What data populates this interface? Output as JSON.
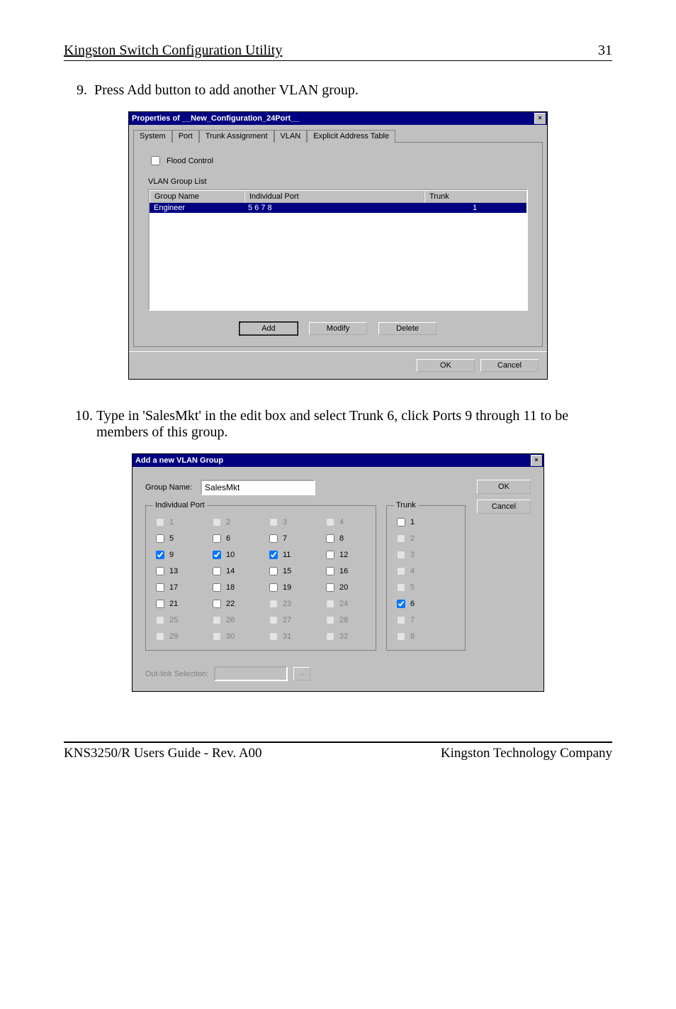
{
  "page": {
    "header_left": "Kingston Switch Configuration Utility",
    "header_right": "31",
    "footer_left": "KNS3250/R Users Guide - Rev. A00",
    "footer_right": "Kingston Technology Company"
  },
  "step9": {
    "num": "9.",
    "text": "Press Add button to add another VLAN group."
  },
  "dialog1": {
    "title": "Properties of __New_Configuration_24Port__",
    "close": "×",
    "tabs": [
      "System",
      "Port",
      "Trunk Assignment",
      "VLAN",
      "Explicit Address Table"
    ],
    "flood_label": "Flood Control",
    "vlan_list_label": "VLAN Group List",
    "cols": {
      "name": "Group Name",
      "port": "Individual Port",
      "trunk": "Trunk"
    },
    "rows": [
      {
        "name": "Engineer",
        "port": "5 6 7 8",
        "trunk": "1"
      }
    ],
    "btns": {
      "add": "Add",
      "modify": "Modify",
      "del": "Delete"
    },
    "ok": "OK",
    "cancel": "Cancel"
  },
  "step10": {
    "num": "10.",
    "text": "Type in 'SalesMkt' in the edit box and select Trunk 6, click Ports 9 through 11 to be members of this group."
  },
  "dialog2": {
    "title": "Add a new VLAN Group",
    "close": "×",
    "group_name_label": "Group Name:",
    "group_name_value": "SalesMkt",
    "ind_legend": "Individual Port",
    "trunk_legend": "Trunk",
    "ports": [
      {
        "n": "1",
        "c": false,
        "d": true
      },
      {
        "n": "2",
        "c": false,
        "d": true
      },
      {
        "n": "3",
        "c": false,
        "d": true
      },
      {
        "n": "4",
        "c": false,
        "d": true
      },
      {
        "n": "5",
        "c": false,
        "d": false
      },
      {
        "n": "6",
        "c": false,
        "d": false
      },
      {
        "n": "7",
        "c": false,
        "d": false
      },
      {
        "n": "8",
        "c": false,
        "d": false
      },
      {
        "n": "9",
        "c": true,
        "d": false
      },
      {
        "n": "10",
        "c": true,
        "d": false
      },
      {
        "n": "11",
        "c": true,
        "d": false
      },
      {
        "n": "12",
        "c": false,
        "d": false
      },
      {
        "n": "13",
        "c": false,
        "d": false
      },
      {
        "n": "14",
        "c": false,
        "d": false
      },
      {
        "n": "15",
        "c": false,
        "d": false
      },
      {
        "n": "16",
        "c": false,
        "d": false
      },
      {
        "n": "17",
        "c": false,
        "d": false
      },
      {
        "n": "18",
        "c": false,
        "d": false
      },
      {
        "n": "19",
        "c": false,
        "d": false
      },
      {
        "n": "20",
        "c": false,
        "d": false
      },
      {
        "n": "21",
        "c": false,
        "d": false
      },
      {
        "n": "22",
        "c": false,
        "d": false
      },
      {
        "n": "23",
        "c": false,
        "d": true
      },
      {
        "n": "24",
        "c": false,
        "d": true
      },
      {
        "n": "25",
        "c": false,
        "d": true
      },
      {
        "n": "26",
        "c": false,
        "d": true
      },
      {
        "n": "27",
        "c": false,
        "d": true
      },
      {
        "n": "28",
        "c": false,
        "d": true
      },
      {
        "n": "29",
        "c": false,
        "d": true
      },
      {
        "n": "30",
        "c": false,
        "d": true
      },
      {
        "n": "31",
        "c": false,
        "d": true
      },
      {
        "n": "32",
        "c": false,
        "d": true
      }
    ],
    "trunks": [
      {
        "n": "1",
        "c": false,
        "d": false
      },
      {
        "n": "2",
        "c": false,
        "d": true
      },
      {
        "n": "3",
        "c": false,
        "d": true
      },
      {
        "n": "4",
        "c": false,
        "d": true
      },
      {
        "n": "5",
        "c": false,
        "d": true
      },
      {
        "n": "6",
        "c": true,
        "d": false
      },
      {
        "n": "7",
        "c": false,
        "d": true
      },
      {
        "n": "8",
        "c": false,
        "d": true
      }
    ],
    "outlink": "Out-link Selection:",
    "dots": "...",
    "ok": "OK",
    "cancel": "Cancel"
  }
}
